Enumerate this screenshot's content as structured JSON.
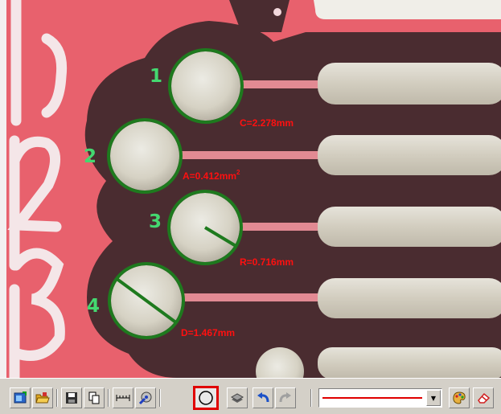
{
  "pins": [
    {
      "label": "1",
      "measurement": "C=2.278mm",
      "superscript": ""
    },
    {
      "label": "2",
      "measurement": "A=0.412mm",
      "superscript": "2"
    },
    {
      "label": "3",
      "measurement": "R=0.716mm",
      "superscript": ""
    },
    {
      "label": "4",
      "measurement": "D=1.467mm",
      "superscript": ""
    }
  ],
  "colors": {
    "board": "#e8616d",
    "solder_mask": "#4a2c30",
    "pad": "#d8d4c8",
    "circle": "#1e7a1e",
    "pin_label": "#44d870",
    "measurement": "#ff1010",
    "toolbar": "#d4d0c8"
  },
  "toolbar": {
    "buttons": [
      {
        "name": "capture-image-button",
        "icon": "image-capture-icon"
      },
      {
        "name": "open-file-button",
        "icon": "folder-open-icon"
      },
      {
        "name": "save-button",
        "icon": "floppy-disk-icon"
      },
      {
        "name": "copy-button",
        "icon": "copy-pages-icon"
      },
      {
        "name": "ruler-button",
        "icon": "ruler-icon"
      },
      {
        "name": "calibrate-button",
        "icon": "calibration-icon"
      },
      {
        "name": "circle-tool-button",
        "icon": "circle-icon",
        "active": true
      },
      {
        "name": "layers-button",
        "icon": "layers-icon"
      },
      {
        "name": "undo-button",
        "icon": "undo-arrow-icon"
      },
      {
        "name": "redo-button",
        "icon": "redo-arrow-icon",
        "disabled": true
      },
      {
        "name": "color-palette-button",
        "icon": "palette-icon"
      },
      {
        "name": "eraser-button",
        "icon": "eraser-icon"
      }
    ],
    "line_style": {
      "color": "#e00000"
    }
  }
}
